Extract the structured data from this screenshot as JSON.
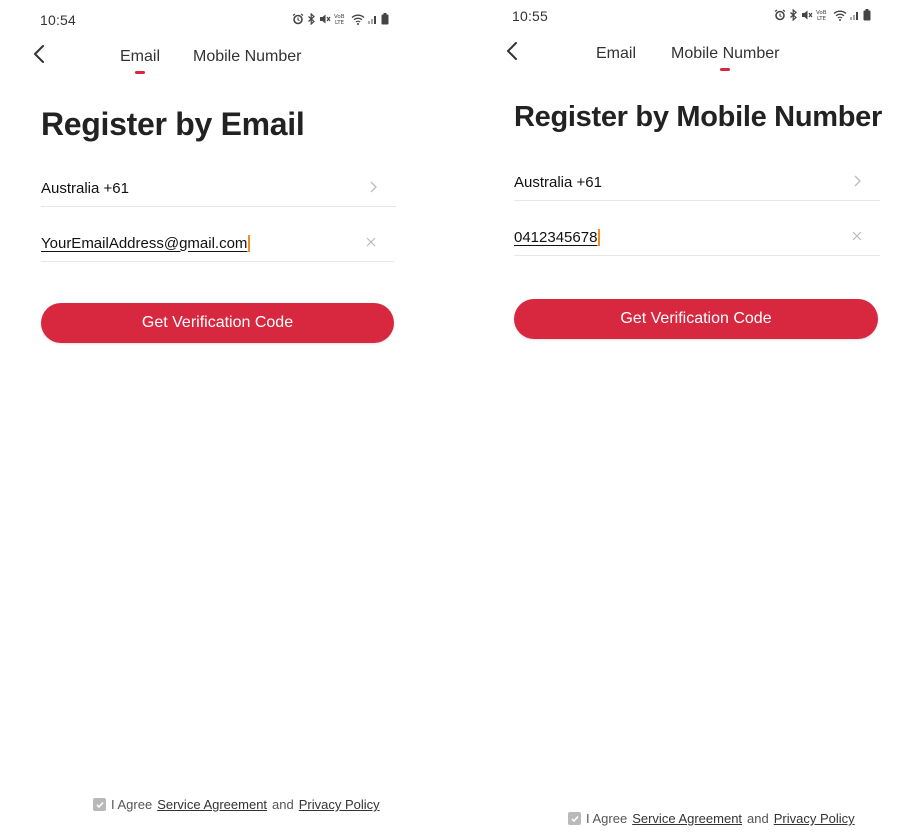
{
  "screens": [
    {
      "status_time": "10:54",
      "tabs": {
        "email": "Email",
        "mobile": "Mobile Number",
        "active": "email"
      },
      "title": "Register by Email",
      "country_field": {
        "value": "Australia +61"
      },
      "input_field": {
        "value": "YourEmailAddress@gmail.com"
      },
      "button_label": "Get Verification Code",
      "agree": {
        "prefix": "I Agree",
        "service_link": "Service Agreement",
        "conjunction": "and",
        "privacy_link": "Privacy Policy",
        "checked": true
      }
    },
    {
      "status_time": "10:55",
      "tabs": {
        "email": "Email",
        "mobile": "Mobile Number",
        "active": "mobile"
      },
      "title": "Register by Mobile Number",
      "country_field": {
        "value": "Australia +61"
      },
      "input_field": {
        "value": "0412345678"
      },
      "button_label": "Get Verification Code",
      "agree": {
        "prefix": "I Agree",
        "service_link": "Service Agreement",
        "conjunction": "and",
        "privacy_link": "Privacy Policy",
        "checked": true
      }
    }
  ],
  "colors": {
    "accent": "#d7283f",
    "tab_indicator": "#d7263d",
    "cursor": "#f28c28",
    "divider": "#e8e8e8",
    "checkbox": "#b9b9b9"
  },
  "status_icons": [
    "alarm-icon",
    "bluetooth-icon",
    "mute-icon",
    "volte-icon",
    "wifi-icon",
    "signal-icon",
    "battery-icon"
  ]
}
